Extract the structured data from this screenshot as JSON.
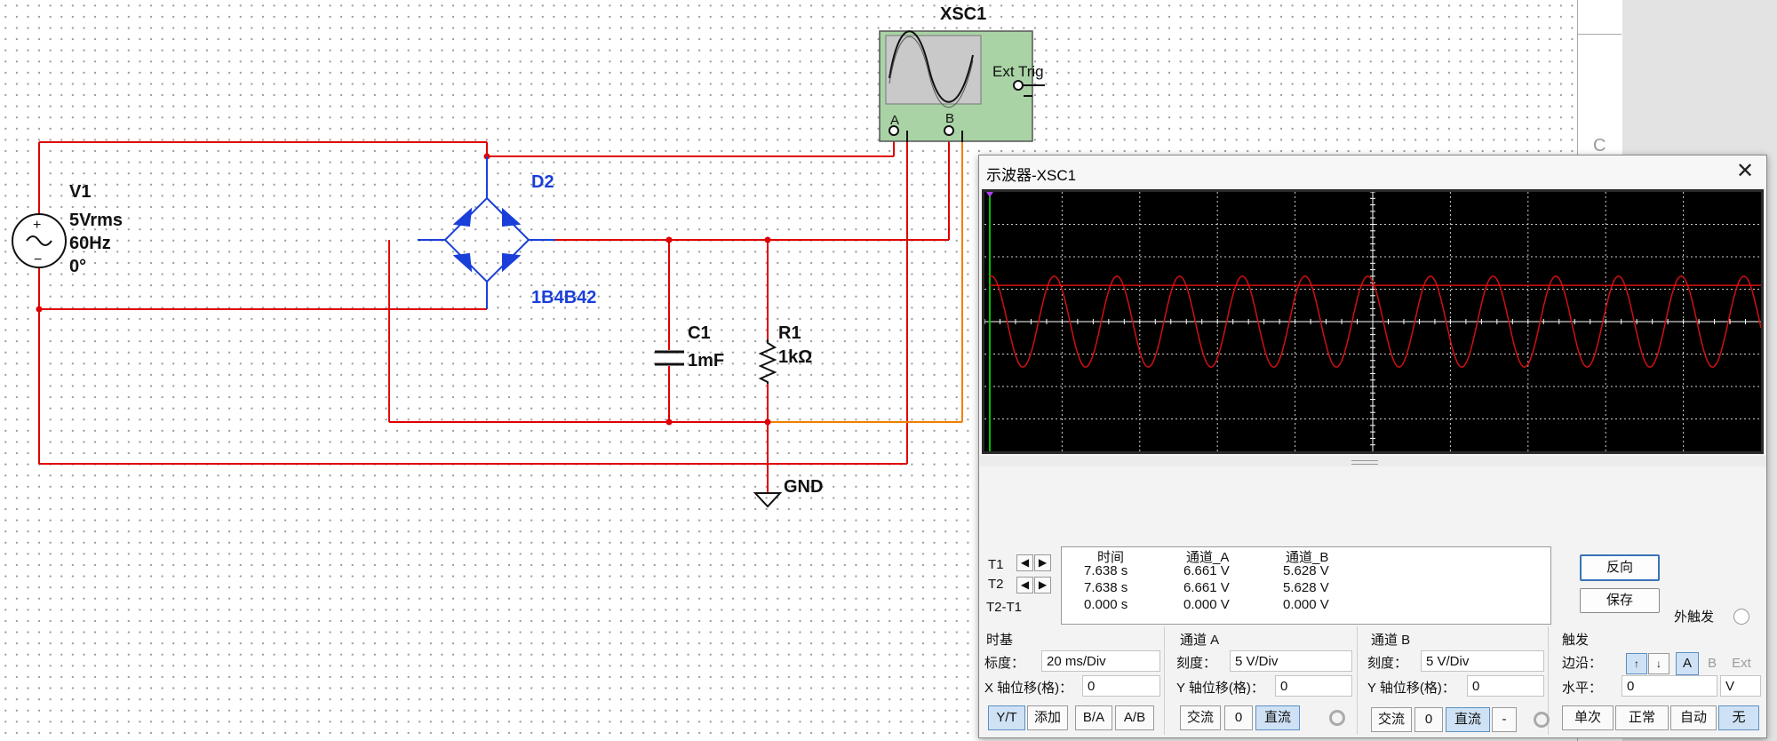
{
  "schematic": {
    "instrument": "XSC1",
    "ext_trig": "Ext Trig",
    "ch_a": "A",
    "ch_b": "B",
    "source": {
      "name": "V1",
      "voltage": "5Vrms",
      "frequency": "60Hz",
      "phase": "0°"
    },
    "bridge": {
      "name": "D2",
      "model": "1B4B42"
    },
    "capacitor": {
      "name": "C1",
      "value": "1mF"
    },
    "resistor": {
      "name": "R1",
      "value": "1kΩ"
    },
    "ground": "GND",
    "sheet_label": "C"
  },
  "oscilloscope": {
    "title": "示波器-XSC1",
    "close": "✕",
    "cursors": {
      "t1": "T1",
      "t2": "T2",
      "diff": "T2-T1"
    },
    "table": {
      "headers": [
        "时间",
        "通道_A",
        "通道_B"
      ],
      "rows": [
        [
          "7.638 s",
          "6.661 V",
          "5.628 V"
        ],
        [
          "7.638 s",
          "6.661 V",
          "5.628 V"
        ],
        [
          "0.000 s",
          "0.000 V",
          "0.000 V"
        ]
      ]
    },
    "buttons": {
      "reverse": "反向",
      "save": "保存",
      "ext_trig": "外触发"
    },
    "timebase": {
      "title": "时基",
      "scale_label": "标度：",
      "scale": "20 ms/Div",
      "xpos_label": "X 轴位移(格)：",
      "xpos": "0",
      "modes": [
        "Y/T",
        "添加",
        "B/A",
        "A/B"
      ]
    },
    "channel_a": {
      "title": "通道 A",
      "scale_label": "刻度：",
      "scale": "5  V/Div",
      "ypos_label": "Y 轴位移(格)：",
      "ypos": "0",
      "coupling": [
        "交流",
        "0",
        "直流"
      ]
    },
    "channel_b": {
      "title": "通道 B",
      "scale_label": "刻度：",
      "scale": "5  V/Div",
      "ypos_label": "Y 轴位移(格)：",
      "ypos": "0",
      "coupling": [
        "交流",
        "0",
        "直流",
        "-"
      ]
    },
    "trigger": {
      "title": "触发",
      "edge_label": "边沿：",
      "sources": [
        "A",
        "B",
        "Ext"
      ],
      "level_label": "水平：",
      "level": "0",
      "level_unit": "V",
      "modes": [
        "单次",
        "正常",
        "自动",
        "无"
      ]
    }
  },
  "chart_data": {
    "type": "line",
    "grid": true,
    "xlabel": "",
    "ylabel": "",
    "x_divisions": 10,
    "y_divisions": 8,
    "x_scale": "20 ms/Div",
    "y_scale": "5 V/Div",
    "xlim": [
      0,
      10
    ],
    "ylim": [
      -4,
      4
    ],
    "series": [
      {
        "color": "#d01010",
        "kind": "sine",
        "amplitude_div": 1.4,
        "offset_div": 0,
        "cycles": 12.3,
        "start_phase_deg": 80
      },
      {
        "color": "#d01010",
        "kind": "constant",
        "offset_div": 1.12
      }
    ],
    "colors": {
      "background": "#000000",
      "grid": "#cfcfcf",
      "cursor": "#00c000",
      "marker": "#b040ff"
    }
  }
}
